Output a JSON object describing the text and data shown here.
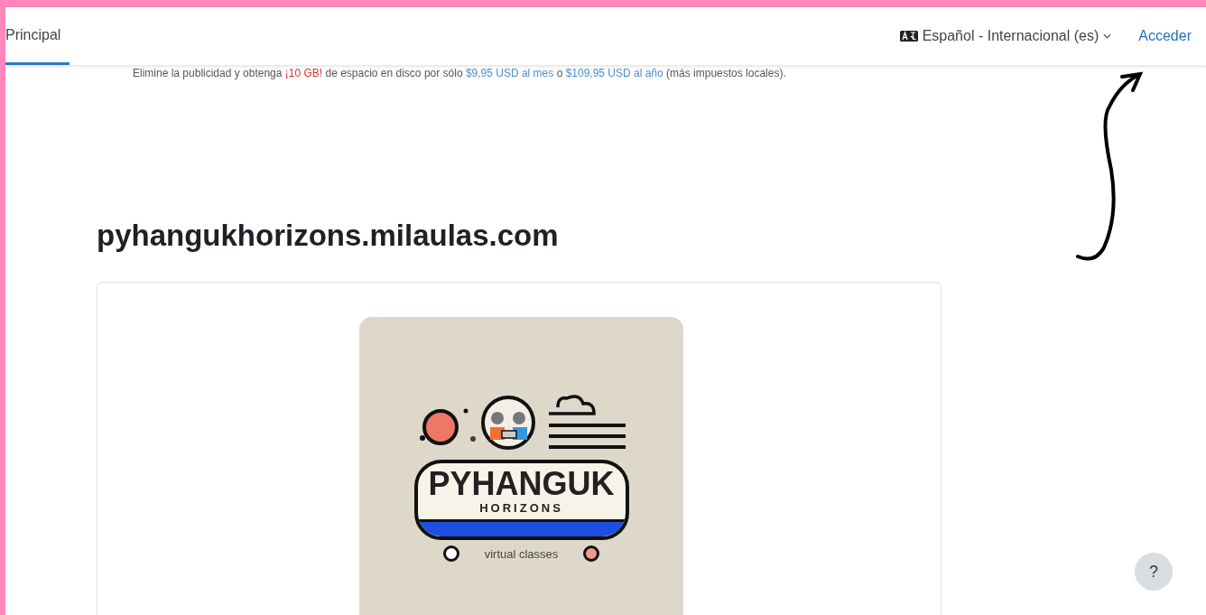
{
  "nav": {
    "tabs": [
      {
        "label": "Principal",
        "selected": true
      }
    ],
    "language": {
      "label": "Español - Internacional (es)"
    },
    "login": "Acceder"
  },
  "banner": [
    {
      "kind": "text",
      "text": "Elimine la publicidad y obtenga "
    },
    {
      "kind": "highlight",
      "text": "¡10 GB!"
    },
    {
      "kind": "text",
      "text": " de espacio en disco por sólo "
    },
    {
      "kind": "link",
      "text": "$9,95 USD al mes"
    },
    {
      "kind": "text",
      "text": " o "
    },
    {
      "kind": "link",
      "text": "$109,95 USD al año"
    },
    {
      "kind": "text",
      "text": " (más impuestos locales)."
    }
  ],
  "site_title": "pyhangukhorizons.milaulas.com",
  "logo": {
    "title": "PYHANGUK",
    "subtitle": "HORIZONS",
    "tagline": "virtual classes"
  },
  "help_button": "?"
}
